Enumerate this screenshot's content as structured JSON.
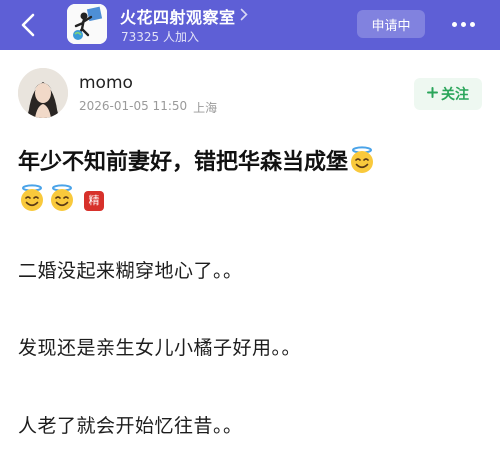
{
  "header": {
    "group_name": "火花四射观察室",
    "member_count": "73325 人加入",
    "apply_label": "申请中",
    "bg_color": "#5e5fd6"
  },
  "post": {
    "author": "momo",
    "date": "2026-01-05 11:50",
    "location": "上海",
    "follow_label": "关注",
    "title": "年少不知前妻好，错把华森当成堡",
    "badge": "精",
    "lines": [
      "二婚没起来糊穿地心了。。",
      "发现还是亲生女儿小橘子好用。。",
      "人老了就会开始忆往昔。。"
    ]
  },
  "icons": {
    "back": "chevron-left-icon",
    "group_chevron": "chevron-right-icon",
    "more": "more-dots-icon",
    "plus": "plus-icon",
    "title_emoji": "smiling-face-with-halo-icon"
  },
  "colors": {
    "follow_green": "#2aa55a",
    "badge_red": "#d7312b"
  }
}
